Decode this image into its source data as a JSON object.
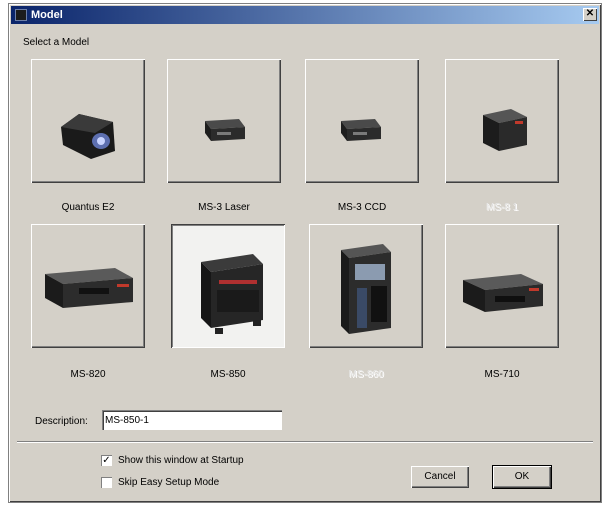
{
  "window": {
    "title": "Model",
    "close_glyph": "✕"
  },
  "select_label": "Select a Model",
  "models": [
    {
      "label": "Quantus E2",
      "icon": "quantus-e2-scanner-icon",
      "selected": false,
      "enabled": true
    },
    {
      "label": "MS-3 Laser",
      "icon": "ms3-laser-scanner-icon",
      "selected": false,
      "enabled": true
    },
    {
      "label": "MS-3 CCD",
      "icon": "ms3-ccd-scanner-icon",
      "selected": false,
      "enabled": true
    },
    {
      "label": "MS-8 1",
      "icon": "ms81-scanner-icon",
      "selected": false,
      "enabled": false
    },
    {
      "label": "MS-820",
      "icon": "ms820-scanner-icon",
      "selected": false,
      "enabled": true
    },
    {
      "label": "MS-850",
      "icon": "ms850-scanner-icon",
      "selected": true,
      "enabled": true
    },
    {
      "label": "MS-860",
      "icon": "ms860-scanner-icon",
      "selected": false,
      "enabled": false
    },
    {
      "label": "MS-710",
      "icon": "ms710-scanner-icon",
      "selected": false,
      "enabled": true
    }
  ],
  "description": {
    "label": "Description:",
    "value": "MS-850-1"
  },
  "options": [
    {
      "label": "Show this window at Startup",
      "checked": true
    },
    {
      "label": "Skip Easy Setup Mode",
      "checked": false
    }
  ],
  "buttons": {
    "cancel": "Cancel",
    "ok": "OK"
  },
  "check_glyph": "✓",
  "colors": {
    "titlebar": "#0a246a",
    "dialog_bg": "#d4d0c8",
    "selected_tile_bg": "#f2f2f0"
  }
}
